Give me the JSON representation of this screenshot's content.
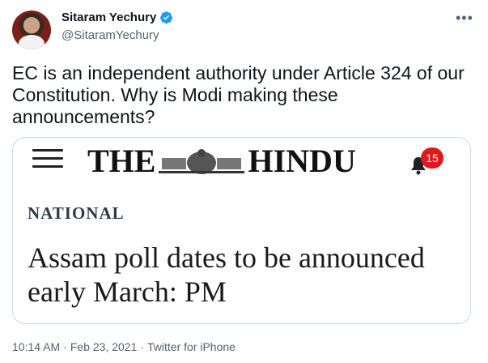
{
  "author": {
    "name": "Sitaram Yechury",
    "handle": "@SitaramYechury",
    "verified": true
  },
  "more_icon": "more-horizontal-icon",
  "tweet": {
    "text": "EC is an independent authority under Article 324 of our Constitution. Why is Modi making these announcements?"
  },
  "card": {
    "masthead_left": "THE",
    "masthead_right": "HINDU",
    "notification_count": "15",
    "section": "NATIONAL",
    "headline": "Assam poll dates to be announced early March: PM"
  },
  "meta": {
    "time": "10:14 AM",
    "date": "Feb 23, 2021",
    "source": "Twitter for iPhone"
  },
  "colors": {
    "verified_blue": "#1d9bf0",
    "badge_red": "#e0191d",
    "muted_text": "#536471"
  }
}
